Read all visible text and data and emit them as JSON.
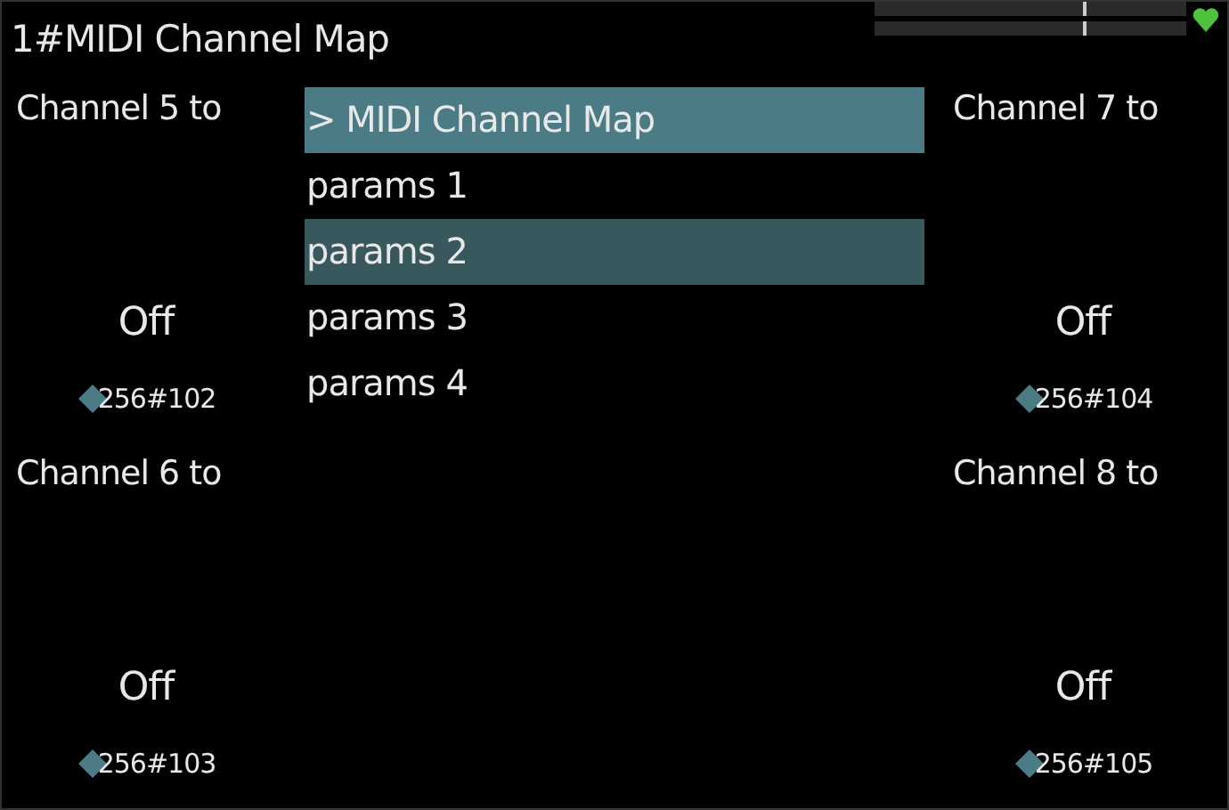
{
  "window": {
    "title": "1#MIDI Channel Map"
  },
  "meters": [
    {
      "level": 0.67
    },
    {
      "level": 0.67
    }
  ],
  "status": {
    "connected": true
  },
  "panels": [
    {
      "label": "Channel  5 to",
      "value": "Off",
      "param": "256#102"
    },
    {
      "label": "Channel  6 to",
      "value": "Off",
      "param": "256#103"
    },
    {
      "label": "Channel  7 to",
      "value": "Off",
      "param": "256#104"
    },
    {
      "label": "Channel  8 to",
      "value": "Off",
      "param": "256#105"
    }
  ],
  "menu": [
    {
      "label": "> MIDI Channel Map",
      "kind": "title",
      "selected": false
    },
    {
      "label": "params 1",
      "kind": "entry",
      "selected": false
    },
    {
      "label": "params 2",
      "kind": "entry",
      "selected": true
    },
    {
      "label": "params 3",
      "kind": "entry",
      "selected": false
    },
    {
      "label": "params 4",
      "kind": "entry",
      "selected": false
    }
  ]
}
